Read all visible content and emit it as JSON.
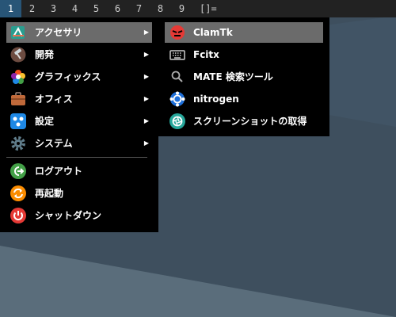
{
  "taskbar": {
    "workspaces": [
      "1",
      "2",
      "3",
      "4",
      "5",
      "6",
      "7",
      "8",
      "9"
    ],
    "active_workspace": "1",
    "layout_indicator": "[]="
  },
  "main_menu": {
    "items": [
      {
        "label": "アクセサリ",
        "icon": "accessories-icon"
      },
      {
        "label": "開発",
        "icon": "hammer-icon"
      },
      {
        "label": "グラフィックス",
        "icon": "graphics-icon"
      },
      {
        "label": "オフィス",
        "icon": "briefcase-icon"
      },
      {
        "label": "設定",
        "icon": "settings-icon"
      },
      {
        "label": "システム",
        "icon": "gear-icon"
      },
      {
        "label": "ログアウト",
        "icon": "logout-icon"
      },
      {
        "label": "再起動",
        "icon": "restart-icon"
      },
      {
        "label": "シャットダウン",
        "icon": "power-icon"
      }
    ],
    "submenu_arrow": "▶"
  },
  "sub_menu": {
    "items": [
      {
        "label": "ClamTk",
        "icon": "clamtk-icon"
      },
      {
        "label": "Fcitx",
        "icon": "keyboard-icon"
      },
      {
        "label": "MATE 検索ツール",
        "icon": "search-icon"
      },
      {
        "label": "nitrogen",
        "icon": "nitrogen-icon"
      },
      {
        "label": "スクリーンショットの取得",
        "icon": "screenshot-icon"
      }
    ]
  },
  "colors": {
    "desktop": "#3d4f5d",
    "menu_bg": "#000000",
    "highlight": "#6b6b6b",
    "active_workspace": "#285577"
  }
}
